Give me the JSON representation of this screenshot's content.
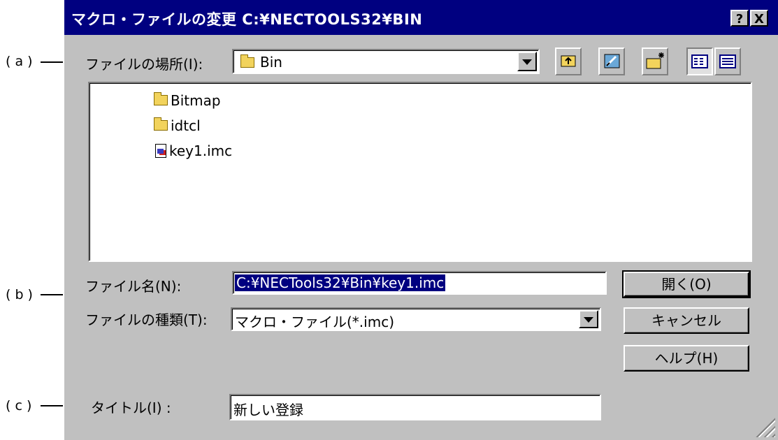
{
  "window": {
    "title": "マクロ・ファイルの変更 C:¥NECTOOLS32¥BIN",
    "help_button": "?",
    "close_button": "X"
  },
  "annotations": [
    "( a )",
    "( b )",
    "( c )"
  ],
  "look_in": {
    "label": "ファイルの場所",
    "accel": "(I):",
    "value": "Bin"
  },
  "toolbar": {
    "icons": [
      "up-one-level-icon",
      "desktop-icon",
      "new-folder-icon",
      "list-view-icon",
      "details-view-icon"
    ]
  },
  "files": [
    {
      "name": "Bitmap",
      "type": "folder"
    },
    {
      "name": "idtcl",
      "type": "folder"
    },
    {
      "name": "key1.imc",
      "type": "file"
    }
  ],
  "filename": {
    "label": "ファイル名",
    "accel": "(N):",
    "value": "C:¥NECTools32¥Bin¥key1.imc"
  },
  "filetype": {
    "label": "ファイルの種類",
    "accel": "(T):",
    "value": "マクロ・ファイル(*.imc)"
  },
  "title_field": {
    "label": "タイトル",
    "accel": "(I) :",
    "value": "新しい登録"
  },
  "buttons": {
    "open": "開く(O)",
    "cancel": "キャンセル",
    "help": "ヘルプ(H)"
  },
  "colors": {
    "titlebar": "#000080",
    "face": "#c0c0c0",
    "selection": "#000080"
  }
}
